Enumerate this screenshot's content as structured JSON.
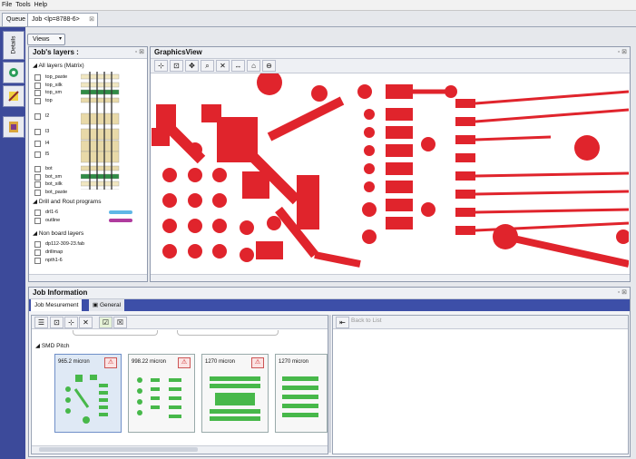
{
  "menu": {
    "file": "File",
    "tools": "Tools",
    "help": "Help"
  },
  "tabs": {
    "queue": "Queue",
    "job": "Job <lp=8788-6>"
  },
  "side": {
    "details": "Details"
  },
  "views": "Views",
  "layers_panel": {
    "title": "Job's layers :",
    "matrix_header": "All layers (Matrix)",
    "layers": [
      "top_paste",
      "top_silk",
      "top_sm",
      "top",
      "l2",
      "l3",
      "l4",
      "l5",
      "bot",
      "bot_sm",
      "bot_silk",
      "bot_paste"
    ],
    "drill_header": "Drill and Rout programs",
    "drill_items": [
      "drl1-6",
      "outline"
    ],
    "nonboard_header": "Non board layers",
    "nonboard_items": [
      "dp112-309-23.fab",
      "drillmap",
      "npth1-6"
    ]
  },
  "graphics": {
    "title": "GraphicsView"
  },
  "job_info": {
    "title": "Job Information",
    "tab_measurement": "Job Mesurement",
    "tab_general": "General",
    "smd_label": "SMD Pitch",
    "back_to_list": "Back to List",
    "cards": [
      "965.2 micron",
      "998.22 micron",
      "1270 micron",
      "1270 micron"
    ]
  },
  "colors": {
    "pcb_red": "#e0242c",
    "pcb_green": "#47b84a",
    "accent_blue": "#3d4fa8"
  }
}
